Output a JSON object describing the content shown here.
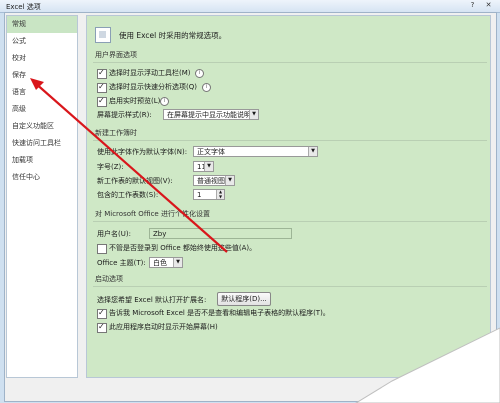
{
  "window": {
    "title": "Excel 选项",
    "help": "?",
    "close": "✕"
  },
  "sidebar": {
    "items": [
      {
        "label": "常规",
        "active": true
      },
      {
        "label": "公式"
      },
      {
        "label": "校对"
      },
      {
        "label": "保存"
      },
      {
        "label": "语言"
      },
      {
        "label": "高级"
      },
      {
        "label": "自定义功能区"
      },
      {
        "label": "快速访问工具栏"
      },
      {
        "label": "加载项"
      },
      {
        "label": "信任中心"
      }
    ]
  },
  "header": {
    "text": "使用 Excel 时采用的常规选项。"
  },
  "ui_options": {
    "section": "用户界面选项",
    "mini_toolbar": "选择时显示浮动工具栏(M)",
    "quick_analysis": "选择时显示快速分析选项(Q)",
    "live_preview": "启用实时预览(L)",
    "tooltip_style_label": "屏幕提示样式(R):",
    "tooltip_style_value": "在屏幕提示中显示功能说明"
  },
  "new_workbook": {
    "section": "新建工作簿时",
    "default_font_label": "使用此字体作为默认字体(N):",
    "default_font_value": "正文字体",
    "font_size_label": "字号(Z):",
    "font_size_value": "11",
    "default_view_label": "新工作表的默认视图(V):",
    "default_view_value": "普通视图",
    "sheets_label": "包含的工作表数(S):",
    "sheets_value": "1"
  },
  "personalize": {
    "section": "对 Microsoft Office 进行个性化设置",
    "username_label": "用户名(U):",
    "username_value": "Zby",
    "always_use_label": "不管是否登录到 Office 都始终使用这些值(A)。",
    "theme_label": "Office 主题(T):",
    "theme_value": "白色"
  },
  "startup": {
    "section": "启动选项",
    "ext_label": "选择您希望 Excel 默认打开扩展名:",
    "default_programs_btn": "默认程序(D)...",
    "not_default_label": "告诉我 Microsoft Excel 是否不是查看和编辑电子表格的默认程序(T)。",
    "start_screen_label": "此应用程序启动时显示开始屏幕(H)"
  },
  "colors": {
    "annotation": "#d9161b",
    "accent_bg": "#cfe8c6",
    "active_item": "#c9e5c4"
  }
}
